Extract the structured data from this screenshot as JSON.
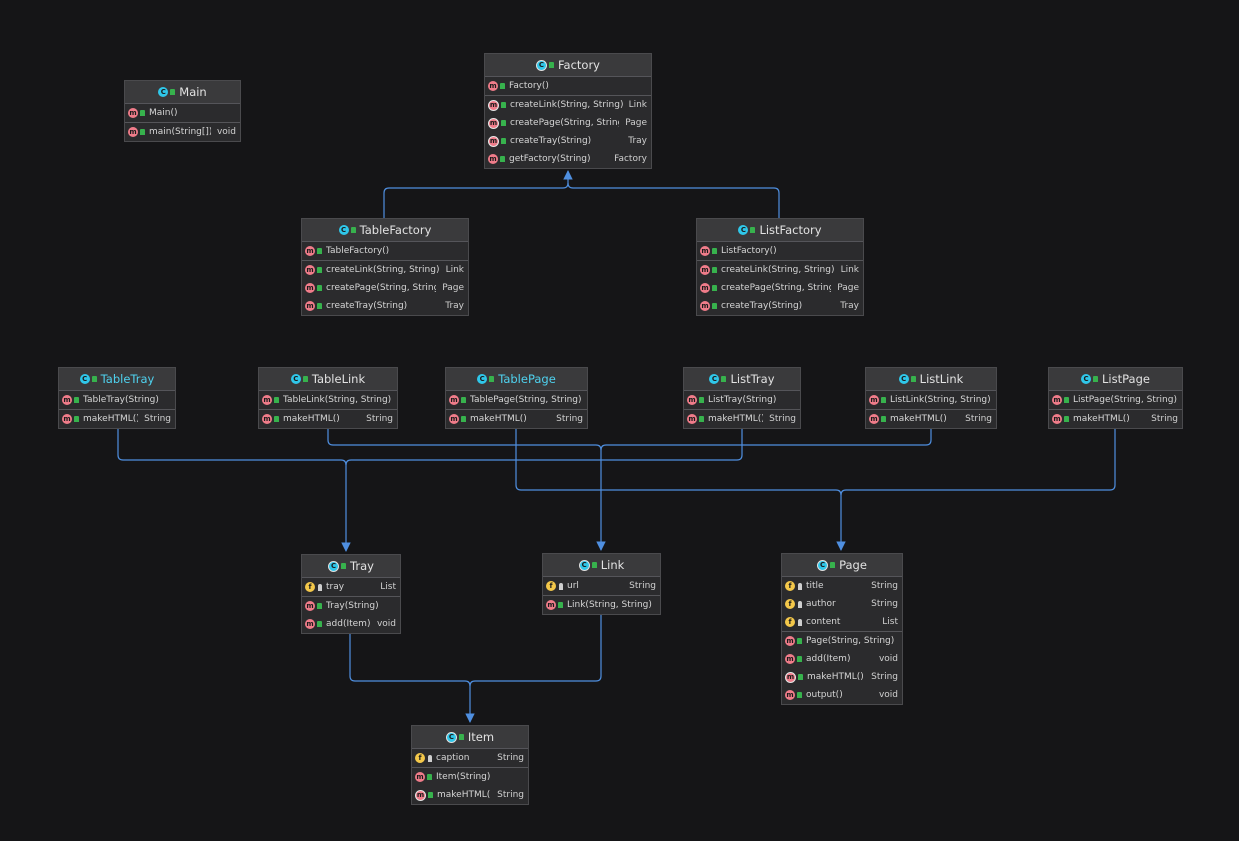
{
  "diagram": {
    "classes": {
      "main": {
        "kind": "class",
        "name": "Main",
        "sections": [
          [
            {
              "icon": "m",
              "vis": "public",
              "name": "Main()",
              "type": ""
            }
          ],
          [
            {
              "icon": "sm",
              "vis": "public",
              "name": "main(String[])",
              "type": "void"
            }
          ]
        ]
      },
      "factory": {
        "kind": "abstract",
        "name": "Factory",
        "sections": [
          [
            {
              "icon": "m",
              "vis": "public",
              "name": "Factory()",
              "type": ""
            }
          ],
          [
            {
              "icon": "am",
              "vis": "public",
              "name": "createLink(String, String)",
              "type": "Link"
            },
            {
              "icon": "am",
              "vis": "public",
              "name": "createPage(String, String)",
              "type": "Page"
            },
            {
              "icon": "am",
              "vis": "public",
              "name": "createTray(String)",
              "type": "Tray"
            },
            {
              "icon": "sm",
              "vis": "public",
              "name": "getFactory(String)",
              "type": "Factory"
            }
          ]
        ]
      },
      "tableFactory": {
        "kind": "class",
        "name": "TableFactory",
        "sections": [
          [
            {
              "icon": "m",
              "vis": "public",
              "name": "TableFactory()",
              "type": ""
            }
          ],
          [
            {
              "icon": "m",
              "vis": "public",
              "name": "createLink(String, String)",
              "type": "Link"
            },
            {
              "icon": "m",
              "vis": "public",
              "name": "createPage(String, String)",
              "type": "Page"
            },
            {
              "icon": "m",
              "vis": "public",
              "name": "createTray(String)",
              "type": "Tray"
            }
          ]
        ]
      },
      "listFactory": {
        "kind": "class",
        "name": "ListFactory",
        "sections": [
          [
            {
              "icon": "m",
              "vis": "public",
              "name": "ListFactory()",
              "type": ""
            }
          ],
          [
            {
              "icon": "m",
              "vis": "public",
              "name": "createLink(String, String)",
              "type": "Link"
            },
            {
              "icon": "m",
              "vis": "public",
              "name": "createPage(String, String)",
              "type": "Page"
            },
            {
              "icon": "m",
              "vis": "public",
              "name": "createTray(String)",
              "type": "Tray"
            }
          ]
        ]
      },
      "tableTray": {
        "kind": "class",
        "name": "TableTray",
        "highlight": true,
        "sections": [
          [
            {
              "icon": "m",
              "vis": "public",
              "name": "TableTray(String)",
              "type": ""
            }
          ],
          [
            {
              "icon": "m",
              "vis": "public",
              "name": "makeHTML()",
              "type": "String"
            }
          ]
        ]
      },
      "tableLink": {
        "kind": "class",
        "name": "TableLink",
        "sections": [
          [
            {
              "icon": "m",
              "vis": "public",
              "name": "TableLink(String, String)",
              "type": ""
            }
          ],
          [
            {
              "icon": "m",
              "vis": "public",
              "name": "makeHTML()",
              "type": "String"
            }
          ]
        ]
      },
      "tablePage": {
        "kind": "class",
        "name": "TablePage",
        "highlight": true,
        "sections": [
          [
            {
              "icon": "m",
              "vis": "public",
              "name": "TablePage(String, String)",
              "type": ""
            }
          ],
          [
            {
              "icon": "m",
              "vis": "public",
              "name": "makeHTML()",
              "type": "String"
            }
          ]
        ]
      },
      "listTray": {
        "kind": "class",
        "name": "ListTray",
        "sections": [
          [
            {
              "icon": "m",
              "vis": "public",
              "name": "ListTray(String)",
              "type": ""
            }
          ],
          [
            {
              "icon": "m",
              "vis": "public",
              "name": "makeHTML()",
              "type": "String"
            }
          ]
        ]
      },
      "listLink": {
        "kind": "class",
        "name": "ListLink",
        "sections": [
          [
            {
              "icon": "m",
              "vis": "public",
              "name": "ListLink(String, String)",
              "type": ""
            }
          ],
          [
            {
              "icon": "m",
              "vis": "public",
              "name": "makeHTML()",
              "type": "String"
            }
          ]
        ]
      },
      "listPage": {
        "kind": "class",
        "name": "ListPage",
        "sections": [
          [
            {
              "icon": "m",
              "vis": "public",
              "name": "ListPage(String, String)",
              "type": ""
            }
          ],
          [
            {
              "icon": "m",
              "vis": "public",
              "name": "makeHTML()",
              "type": "String"
            }
          ]
        ]
      },
      "tray": {
        "kind": "abstract",
        "name": "Tray",
        "sections": [
          [
            {
              "icon": "f",
              "vis": "package",
              "name": "tray",
              "type": "List"
            }
          ],
          [
            {
              "icon": "m",
              "vis": "public",
              "name": "Tray(String)",
              "type": ""
            },
            {
              "icon": "m",
              "vis": "public",
              "name": "add(Item)",
              "type": "void"
            }
          ]
        ]
      },
      "link": {
        "kind": "abstract",
        "name": "Link",
        "sections": [
          [
            {
              "icon": "f",
              "vis": "package",
              "name": "url",
              "type": "String"
            }
          ],
          [
            {
              "icon": "m",
              "vis": "public",
              "name": "Link(String, String)",
              "type": ""
            }
          ]
        ]
      },
      "page": {
        "kind": "abstract",
        "name": "Page",
        "sections": [
          [
            {
              "icon": "f",
              "vis": "package",
              "name": "title",
              "type": "String"
            },
            {
              "icon": "f",
              "vis": "package",
              "name": "author",
              "type": "String"
            },
            {
              "icon": "f",
              "vis": "package",
              "name": "content",
              "type": "List"
            }
          ],
          [
            {
              "icon": "m",
              "vis": "public",
              "name": "Page(String, String)",
              "type": ""
            },
            {
              "icon": "m",
              "vis": "public",
              "name": "add(Item)",
              "type": "void"
            },
            {
              "icon": "am",
              "vis": "public",
              "name": "makeHTML()",
              "type": "String"
            },
            {
              "icon": "m",
              "vis": "public",
              "name": "output()",
              "type": "void"
            }
          ]
        ]
      },
      "item": {
        "kind": "abstract",
        "name": "Item",
        "sections": [
          [
            {
              "icon": "f",
              "vis": "package",
              "name": "caption",
              "type": "String"
            }
          ],
          [
            {
              "icon": "m",
              "vis": "public",
              "name": "Item(String)",
              "type": ""
            },
            {
              "icon": "am",
              "vis": "public",
              "name": "makeHTML()",
              "type": "String"
            }
          ]
        ]
      }
    },
    "colors": {
      "background": "#151517",
      "edge": "#4f8fe0",
      "highlight": "#4fd2ef"
    }
  }
}
